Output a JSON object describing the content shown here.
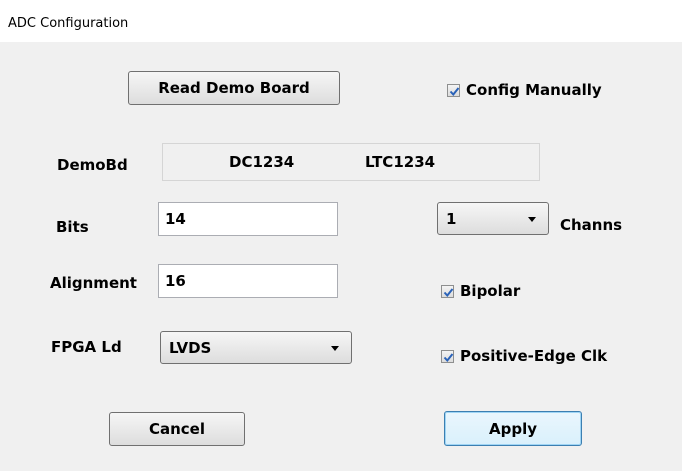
{
  "window": {
    "title": "ADC Configuration"
  },
  "buttons": {
    "read_demo_board": "Read Demo Board",
    "cancel": "Cancel",
    "apply": "Apply"
  },
  "config_manually": {
    "label": "Config Manually",
    "checked": true
  },
  "demo_board": {
    "label": "DemoBd",
    "board": "DC1234",
    "part": "LTC1234"
  },
  "bits": {
    "label": "Bits",
    "value": "14"
  },
  "alignment": {
    "label": "Alignment",
    "value": "16"
  },
  "fpga": {
    "label": "FPGA Ld",
    "selected": "LVDS"
  },
  "channels": {
    "selected": "1",
    "label": "Channs"
  },
  "bipolar": {
    "label": "Bipolar",
    "checked": true
  },
  "positive_edge_clk": {
    "label": "Positive-Edge Clk",
    "checked": true
  },
  "icons": {
    "checkmark": "checkmark-icon",
    "dropdown": "chevron-down-icon"
  },
  "colors": {
    "checkmark": "#2a62b8",
    "default_button_border": "#3c7fb1",
    "dialog_background": "#f0f0f0"
  }
}
